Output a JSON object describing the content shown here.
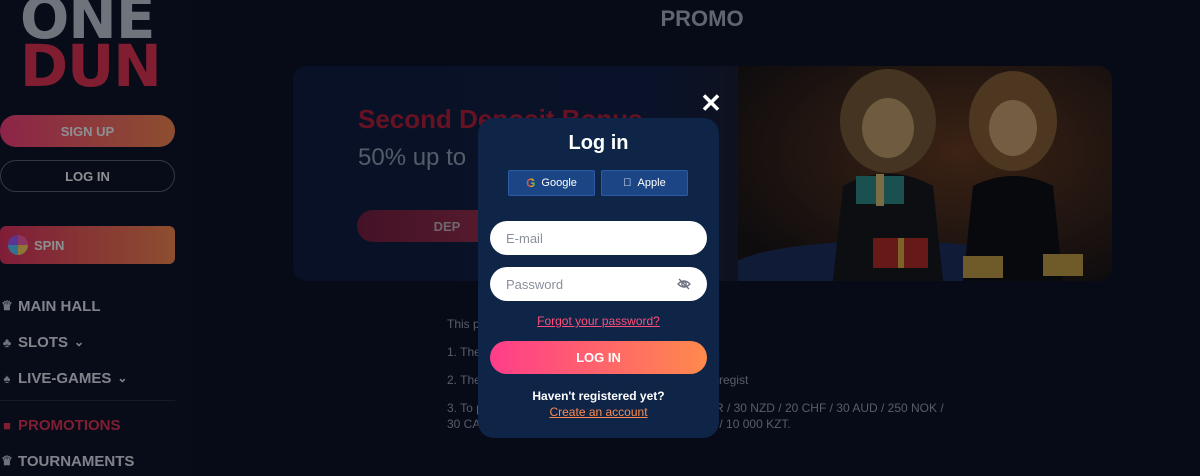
{
  "logo": {
    "line1": "ONE",
    "line2": "DUN"
  },
  "sidebar": {
    "signup_label": "SIGN UP",
    "login_label": "LOG IN",
    "spin_label": "SPIN",
    "nav": [
      {
        "label": "MAIN HALL",
        "icon": "trophy-icon"
      },
      {
        "label": "SLOTS",
        "icon": "cherry-icon"
      },
      {
        "label": "LIVE-GAMES",
        "icon": "spade-icon"
      },
      {
        "label": "PROMOTIONS",
        "icon": "gift-icon"
      },
      {
        "label": "TOURNAMENTS",
        "icon": "trophy-icon"
      }
    ]
  },
  "page": {
    "title": "PROMO"
  },
  "banner": {
    "title": "Second Deposit Bonus",
    "subtitle": "50% up to",
    "button_label": "DEP"
  },
  "terms": {
    "p1": "This p                                                                    sino.",
    "p2": "1. The                                                                    made at on Onedun Casino.",
    "p3": "2. The                                                                    o Sunday 23:59 UTC each week. Additional regist",
    "p4": "3. To pa                                                                    nake a deposit of at least 20 USD / 20 EUR / 30 NZD /  20 CHF / 30 AUD / 250 NOK / 30 CAD / 100 PLN / 250 SEK / 750 TRY / 120 BRL / 10 000 KZT."
  },
  "modal": {
    "title": "Log in",
    "google_label": "Google",
    "apple_label": "Apple",
    "email_placeholder": "E-mail",
    "password_placeholder": "Password",
    "forgot_label": "Forgot your password?",
    "login_button": "LOG IN",
    "not_registered": "Haven't registered yet?",
    "create_account": "Create an account"
  },
  "colors": {
    "accent": "#e8304f",
    "modal_bg": "#0e2548",
    "page_bg": "#0b1020"
  }
}
